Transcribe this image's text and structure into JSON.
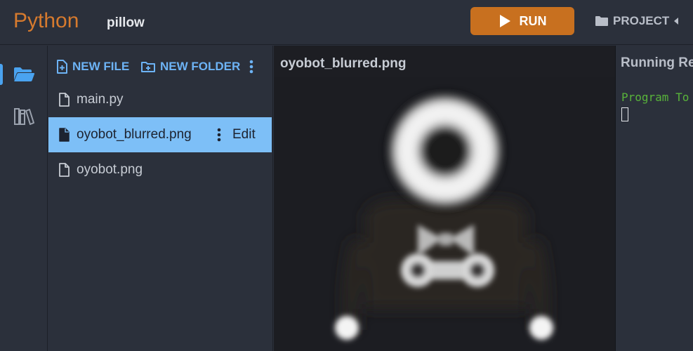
{
  "header": {
    "app_title": "Python",
    "project_name": "pillow",
    "run_label": "RUN",
    "project_label": "PROJECT"
  },
  "rail": {
    "items": [
      {
        "icon": "folder-open-icon",
        "active": true
      },
      {
        "icon": "library-icon",
        "active": false
      }
    ]
  },
  "files": {
    "new_file_label": "NEW FILE",
    "new_folder_label": "NEW FOLDER",
    "items": [
      {
        "name": "main.py",
        "selected": false
      },
      {
        "name": "oyobot_blurred.png",
        "selected": true,
        "action_label": "Edit"
      },
      {
        "name": "oyobot.png",
        "selected": false
      }
    ]
  },
  "preview": {
    "title": "oyobot_blurred.png"
  },
  "output": {
    "title": "Running Re",
    "text": "Program To"
  },
  "colors": {
    "accent": "#d67a2e",
    "run_button": "#c8701f",
    "link_blue": "#6db3f5",
    "selection": "#7dbff7",
    "output_green": "#58b33a"
  }
}
